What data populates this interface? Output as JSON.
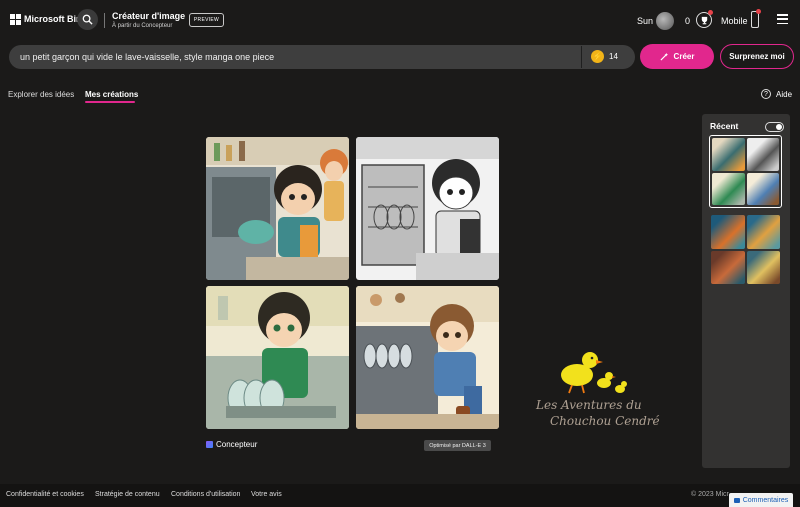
{
  "header": {
    "brand": "Microsoft Bing",
    "app_title": "Créateur d'image",
    "app_subtitle": "À partir du Concepteur",
    "preview_badge": "PREVIEW",
    "user_name": "Sun",
    "points": "0",
    "mobile_label": "Mobile"
  },
  "search": {
    "prompt": "un petit garçon qui vide le lave-vaisselle, style manga one piece",
    "boosts": "14",
    "create_label": "Créer",
    "surprise_label": "Surprenez moi"
  },
  "tabs": {
    "explore": "Explorer des idées",
    "mine": "Mes créations",
    "help": "Aide"
  },
  "results": {
    "designer_label": "Concepteur",
    "model_badge": "Optimisé par DALL-E 3"
  },
  "watermark": {
    "line1": "Les Aventures du",
    "line2": "Chouchou Cendré"
  },
  "recent": {
    "title": "Récent"
  },
  "footer": {
    "privacy": "Confidentialité et cookies",
    "content_policy": "Stratégie de contenu",
    "terms": "Conditions d'utilisation",
    "feedback_link": "Votre avis",
    "copyright": "© 2023 Micr",
    "comments": "Commentaires"
  },
  "colors": {
    "accent": "#e1278d",
    "background": "#1b1a19"
  }
}
